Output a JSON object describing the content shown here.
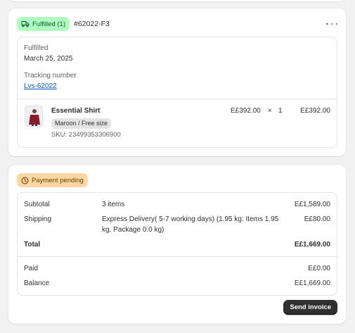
{
  "fulfillment": {
    "status_badge": "Fulfilled (1)",
    "order_number": "#62022-F3",
    "fulfilled_label": "Fulfilled",
    "fulfilled_date": "March 25, 2025",
    "tracking_label": "Tracking number",
    "tracking_number": "Lvs-62022",
    "product": {
      "name": "Essential Shirt",
      "variant": "Maroon / Free size",
      "sku": "SKU: 23499353306900",
      "unit_price": "E£392.00",
      "multiply": "×",
      "quantity": "1",
      "total": "E£392.00"
    }
  },
  "payment": {
    "status_badge": "Payment pending",
    "subtotal_label": "Subtotal",
    "subtotal_items": "3 items",
    "subtotal_value": "E£1,589.00",
    "shipping_label": "Shipping",
    "shipping_desc_line1": "Express Delivery( 5-7 working days) (1.95 kg: Items 1.95",
    "shipping_desc_line2": "kg, Package 0.0 kg)",
    "shipping_value": "E£80.00",
    "total_label": "Total",
    "total_value": "E£1,669.00",
    "paid_label": "Paid",
    "paid_value": "E£0.00",
    "balance_label": "Balance",
    "balance_value": "E£1,669.00",
    "send_invoice_label": "Send invoice"
  },
  "colors": {
    "fulfilled_badge_bg": "#affebf",
    "pending_badge_bg": "#ffd6a4",
    "link": "#005bd3"
  },
  "icons": {
    "fulfilled_badge": "delivery-truck-icon",
    "pending_badge": "clock-icon",
    "menu": "more-horizontal-icon"
  }
}
